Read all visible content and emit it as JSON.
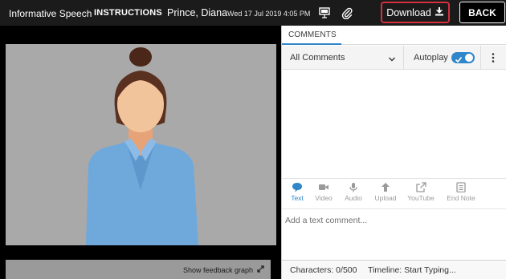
{
  "header": {
    "assignment_title": "Informative Speech",
    "instructions_label": "INSTRUCTIONS",
    "student_name": "Prince, Diana",
    "datetime": "Wed 17 Jul 2019 4:05 PM",
    "download_label": "Download",
    "back_label": "BACK",
    "present_icon": "presentation-icon",
    "attachment_icon": "paperclip-icon",
    "download_icon": "download-icon"
  },
  "video": {
    "feedback_graph_label": "Show feedback graph",
    "expand_icon": "expand-arrows-icon"
  },
  "comments": {
    "tab_label": "COMMENTS",
    "filter_value": "All Comments",
    "autoplay_label": "Autoplay",
    "autoplay_on": true,
    "tools": [
      {
        "label": "Text",
        "icon": "speech-bubble-icon",
        "active": true
      },
      {
        "label": "Video",
        "icon": "video-camera-icon",
        "active": false
      },
      {
        "label": "Audio",
        "icon": "microphone-icon",
        "active": false
      },
      {
        "label": "Upload",
        "icon": "upload-arrow-icon",
        "active": false
      },
      {
        "label": "YouTube",
        "icon": "external-link-icon",
        "active": false
      },
      {
        "label": "End Note",
        "icon": "note-icon",
        "active": false
      }
    ],
    "input_placeholder": "Add a text comment...",
    "characters_text": "Characters: 0/500",
    "timeline_text": "Timeline:  Start Typing..."
  },
  "colors": {
    "accent": "#2f86c9",
    "download_border": "#d4303f",
    "header_bg": "#1b1b1b"
  }
}
